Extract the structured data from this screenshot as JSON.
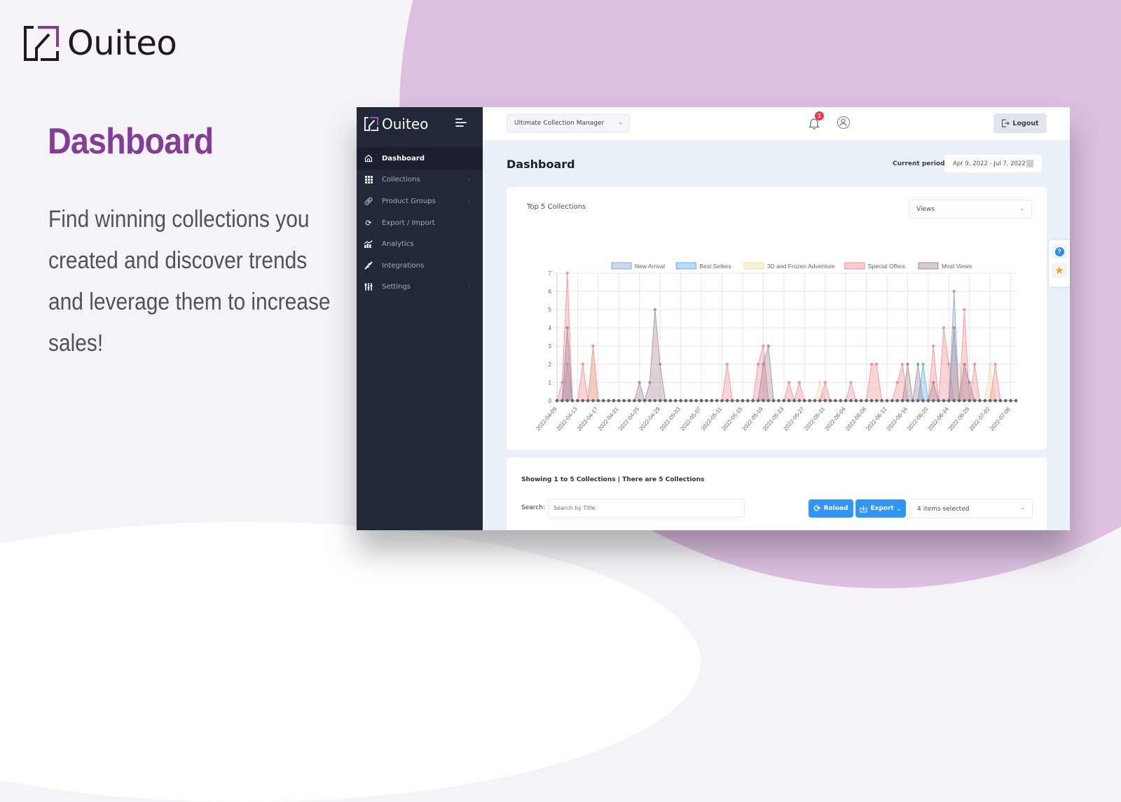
{
  "brand": {
    "name": "Ouiteo"
  },
  "hero": {
    "title": "Dashboard",
    "description": "Find winning collections you created and discover trends and leverage them to increase sales!"
  },
  "colors": {
    "accent_purple": "#833d96",
    "sidebar_bg": "#232839",
    "primary_blue": "#3196f3",
    "badge_red": "#ef3a4e",
    "bg_circle": "#dcbfe1"
  },
  "app": {
    "sidebar": {
      "logo": "Ouiteo",
      "menu_toggle_icon": "menu-toggle-icon",
      "items": [
        {
          "label": "Dashboard",
          "icon": "home-icon",
          "active": true,
          "has_submenu": false
        },
        {
          "label": "Collections",
          "icon": "grid-icon",
          "active": false,
          "has_submenu": true
        },
        {
          "label": "Product Groups",
          "icon": "link-icon",
          "active": false,
          "has_submenu": true
        },
        {
          "label": "Export / Import",
          "icon": "sync-icon",
          "active": false,
          "has_submenu": false
        },
        {
          "label": "Analytics",
          "icon": "chart-icon",
          "active": false,
          "has_submenu": false
        },
        {
          "label": "Integrations",
          "icon": "plug-icon",
          "active": false,
          "has_submenu": false
        },
        {
          "label": "Settings",
          "icon": "sliders-icon",
          "active": false,
          "has_submenu": true
        }
      ]
    },
    "topbar": {
      "store_select": "Ultimate Collection Manager",
      "notification_count": "1",
      "logout_label": "Logout"
    },
    "page": {
      "title": "Dashboard",
      "period_label": "Current period:",
      "period_value": "Apr 9, 2022 - Jul 7, 2022"
    },
    "chart_card": {
      "title": "Top 5 Collections",
      "metric_select": "Views"
    },
    "table_card": {
      "showing_text": "Showing 1 to 5 Collections | There are 5 Collections",
      "search_label": "Search:",
      "search_placeholder": "Search by Title",
      "reload_label": "Reload",
      "export_label": "Export",
      "columns_select": "4 items selected"
    },
    "float_tools": [
      "help-icon",
      "star-icon"
    ]
  },
  "chart_data": {
    "type": "area",
    "title": "Top 5 Collections",
    "xlabel": "",
    "ylabel": "",
    "ylim": [
      0,
      7
    ],
    "yticks": [
      0,
      1,
      2,
      3,
      4,
      5,
      6,
      7
    ],
    "grid": true,
    "legend_position": "top-center",
    "x_start": "2022-04-09",
    "x_end": "2022-07-07",
    "x_tick_labels": [
      "2022-04-09",
      "2022-04-13",
      "2022-04-17",
      "2022-04-21",
      "2022-04-25",
      "2022-04-29",
      "2022-05-03",
      "2022-05-07",
      "2022-05-11",
      "2022-05-15",
      "2022-05-19",
      "2022-05-23",
      "2022-05-27",
      "2022-05-31",
      "2022-06-04",
      "2022-06-08",
      "2022-06-12",
      "2022-06-16",
      "2022-06-20",
      "2022-06-24",
      "2022-06-28",
      "2022-07-02",
      "2022-07-06"
    ],
    "series": [
      {
        "name": "New Arrival",
        "color": "#8aa6dd",
        "points": {
          "2022-04-11": 2,
          "2022-06-25": 6
        }
      },
      {
        "name": "Best Sellers",
        "color": "#5fb3ea",
        "points": {
          "2022-06-19": 2
        }
      },
      {
        "name": "3D and Frozen Adventure",
        "color": "#eedfa0",
        "points": {
          "2022-04-16": 3,
          "2022-05-30": 1,
          "2022-06-26": 2,
          "2022-07-02": 2
        }
      },
      {
        "name": "Special Offers",
        "color": "#f58d93",
        "points": {
          "2022-04-10": 1,
          "2022-04-11": 7,
          "2022-04-14": 2,
          "2022-04-16": 3,
          "2022-05-12": 2,
          "2022-05-18": 2,
          "2022-05-19": 3,
          "2022-05-24": 1,
          "2022-05-26": 1,
          "2022-05-31": 1,
          "2022-06-05": 1,
          "2022-06-09": 2,
          "2022-06-10": 2,
          "2022-06-14": 1,
          "2022-06-15": 2,
          "2022-06-21": 3,
          "2022-06-23": 4,
          "2022-06-24": 2,
          "2022-06-27": 5,
          "2022-06-29": 2,
          "2022-07-03": 2
        }
      },
      {
        "name": "Most Views",
        "color": "#a5899a",
        "points": {
          "2022-04-11": 4,
          "2022-04-25": 1,
          "2022-04-27": 1,
          "2022-04-28": 5,
          "2022-04-29": 2,
          "2022-05-19": 2,
          "2022-05-20": 3,
          "2022-06-16": 2,
          "2022-06-18": 2,
          "2022-06-21": 1,
          "2022-06-25": 4,
          "2022-06-27": 2,
          "2022-06-28": 1
        }
      }
    ]
  }
}
